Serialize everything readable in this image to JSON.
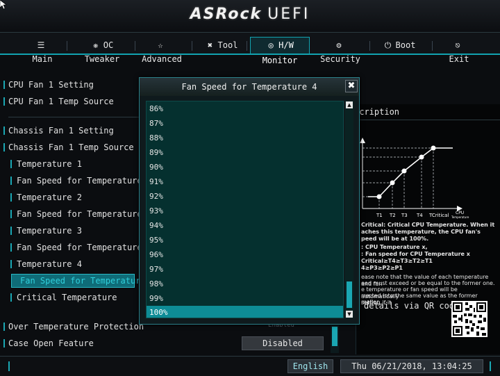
{
  "header": {
    "brand": "ASRock",
    "product": "UEFI"
  },
  "tabs": [
    {
      "label": "Main",
      "icon": "list-icon"
    },
    {
      "label": "OC Tweaker",
      "icon": "tweaker-icon"
    },
    {
      "label": "Advanced",
      "icon": "star-icon"
    },
    {
      "label": "Tool",
      "icon": "tool-icon"
    },
    {
      "label": "H/W Monitor",
      "icon": "monitor-icon"
    },
    {
      "label": "Security",
      "icon": "shield-icon"
    },
    {
      "label": "Boot",
      "icon": "power-icon"
    },
    {
      "label": "Exit",
      "icon": "exit-icon"
    }
  ],
  "active_tab": "H/W Monitor",
  "menu": [
    "CPU Fan 1 Setting",
    "CPU Fan 1 Temp Source",
    "Chassis Fan 1 Setting",
    "Chassis Fan 1 Temp Source",
    "Temperature 1",
    "Fan Speed for Temperature 1",
    "Temperature 2",
    "Fan Speed for Temperature 2",
    "Temperature 3",
    "Fan Speed for Temperature 3",
    "Temperature 4",
    "Fan Speed for Temperature 4",
    "Critical Temperature",
    "Over Temperature Protection",
    "Case Open Feature"
  ],
  "values": {
    "over_temp_ghost": "Enabled",
    "case_open": "Disabled"
  },
  "description": {
    "title": "scription",
    "graph_labels": [
      "T1",
      "T2",
      "T3",
      "T4",
      "TCritical",
      "CPU",
      "Temperature"
    ],
    "text1": "Critical: Critical CPU Temperature. When it",
    "text2": "aches this temperature, the CPU fan's",
    "text3": "peed will be at 100%.",
    "text4": ": CPU Temperature x,",
    "text5": ": Fan speed for CPU Temperature x",
    "text6": "Critical≥T4≥T3≥T2≥T1",
    "text7": "4≥P3≥P2≥P1",
    "note1": "ease note that the value of each temperature and fan",
    "note2": "eed must exceed or be equal to the former one.",
    "note3": "e temperature or fan speed will be automatically",
    "note4": "rrected into the same value as the former setting if it",
    "note5": "maller.",
    "qr_label": "details via QR code"
  },
  "dialog": {
    "title": "Fan Speed for Temperature 4",
    "close": "✖",
    "options": [
      "86%",
      "87%",
      "88%",
      "89%",
      "90%",
      "91%",
      "92%",
      "93%",
      "94%",
      "95%",
      "96%",
      "97%",
      "98%",
      "99%",
      "100%"
    ],
    "selected": "100%"
  },
  "footer": {
    "language": "English",
    "datetime": "Thu 06/21/2018, 13:04:25"
  },
  "colors": {
    "accent": "#1aa7b3",
    "selected_row": "#0e8c96",
    "list_bg": "#05302f"
  }
}
